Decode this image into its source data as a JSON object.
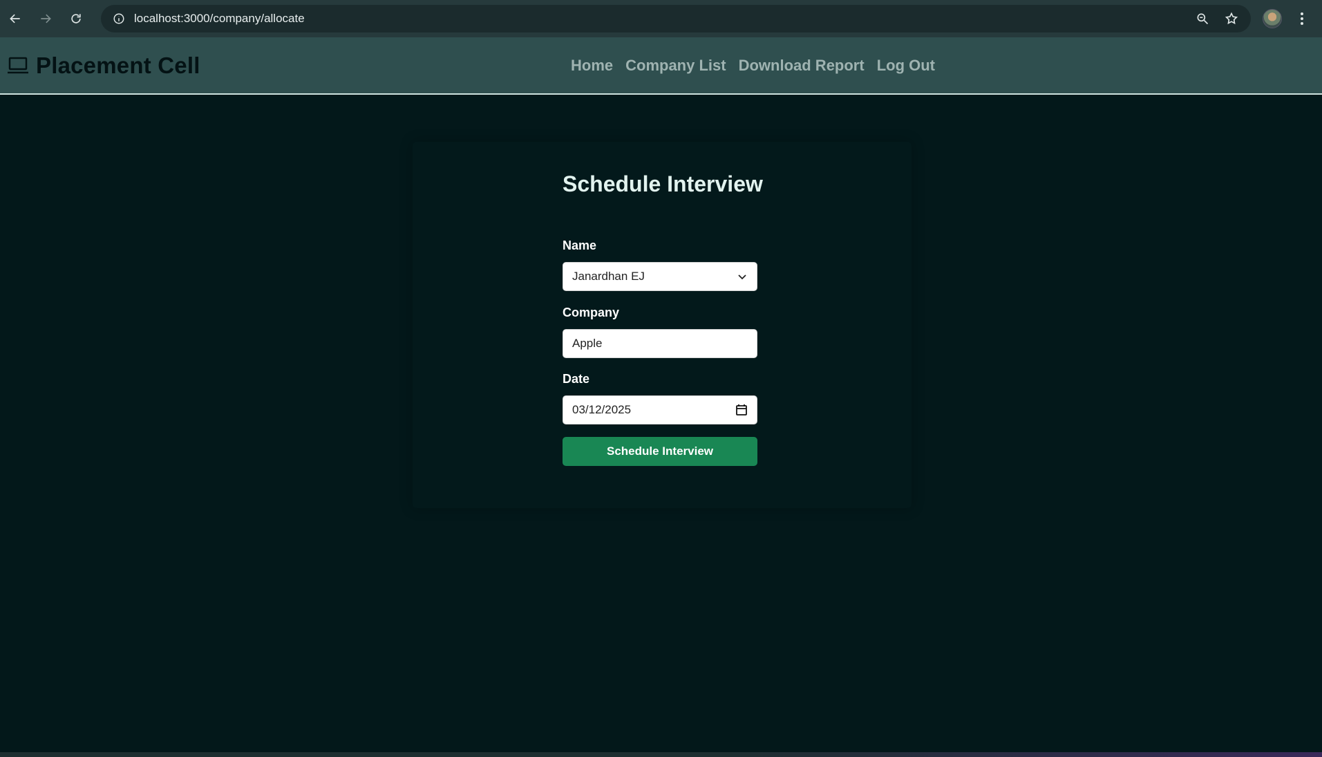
{
  "browser": {
    "url": "localhost:3000/company/allocate"
  },
  "app": {
    "brand": "Placement Cell",
    "nav": [
      {
        "label": "Home"
      },
      {
        "label": "Company List"
      },
      {
        "label": "Download Report"
      },
      {
        "label": "Log Out"
      }
    ]
  },
  "form": {
    "title": "Schedule Interview",
    "name_label": "Name",
    "name_value": "Janardhan EJ",
    "company_label": "Company",
    "company_value": "Apple",
    "date_label": "Date",
    "date_value": "03/12/2025",
    "submit_label": "Schedule Interview"
  },
  "colors": {
    "page_bg": "#03181a",
    "header_bg": "#2f4f4f",
    "nav_link": "#9fb3b1",
    "submit_bg": "#198754"
  },
  "icons": [
    "back-icon",
    "forward-icon",
    "reload-icon",
    "info-icon",
    "zoom-icon",
    "star-icon",
    "profile-avatar",
    "more-icon",
    "laptop-icon",
    "chevron-down-icon",
    "calendar-icon"
  ]
}
